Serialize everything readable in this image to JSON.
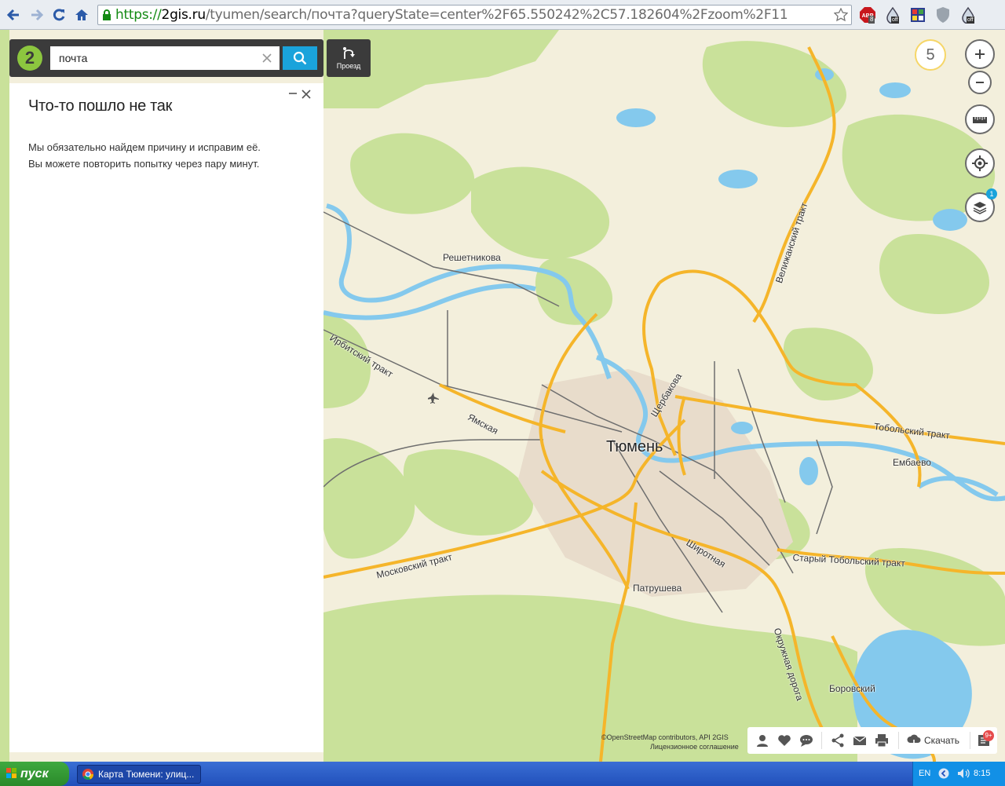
{
  "browser": {
    "url_scheme": "https://",
    "url_host": "2gis.ru",
    "url_rest": "/tyumen/search/почта?queryState=center%2F65.550242%2C57.182604%2Fzoom%2F11",
    "abp_badge": "8",
    "ext_off_1": "off",
    "ext_off_2": "off"
  },
  "search": {
    "query": "почта",
    "route_label": "Проезд"
  },
  "panel": {
    "title": "Что-то пошло не так",
    "message_line1": "Мы обязательно найдем причину и исправим её.",
    "message_line2": "Вы можете повторить попытку через пару минут."
  },
  "controls": {
    "zoom_level": "5",
    "layers_badge": "1"
  },
  "map_labels": {
    "city": "Тюмень",
    "reshetnikova": "Решетникова",
    "irbitsky": "Ирбитский тракт",
    "yamskaya": "Ямская",
    "moskovsky": "Московский тракт",
    "patrusheva": "Патрушева",
    "shirotnaya": "Широтная",
    "shcherbakova": "Щербакова",
    "velizhansky": "Велижанский тракт",
    "tobolsky": "Тобольский тракт",
    "embaevo": "Ембаево",
    "stary_tobolsky": "Старый Тобольский тракт",
    "okruzhnaya": "Окружная дорога",
    "borovsky": "Боровский"
  },
  "toolbar": {
    "download_label": "Скачать",
    "notif_badge": "9+",
    "copyright_line1": "©OpenStreetMap contributors, API 2GIS",
    "copyright_line2": "Лицензионное соглашение"
  },
  "taskbar": {
    "start_label": "пуск",
    "task_label": "Карта Тюмени: улиц...",
    "lang": "EN",
    "clock": "8:15"
  },
  "colors": {
    "search_blue": "#1aa3db",
    "logo_green": "#8cc63f",
    "road_orange": "#f5b52a",
    "water": "#84c9ed",
    "forest": "#c9e19a"
  }
}
